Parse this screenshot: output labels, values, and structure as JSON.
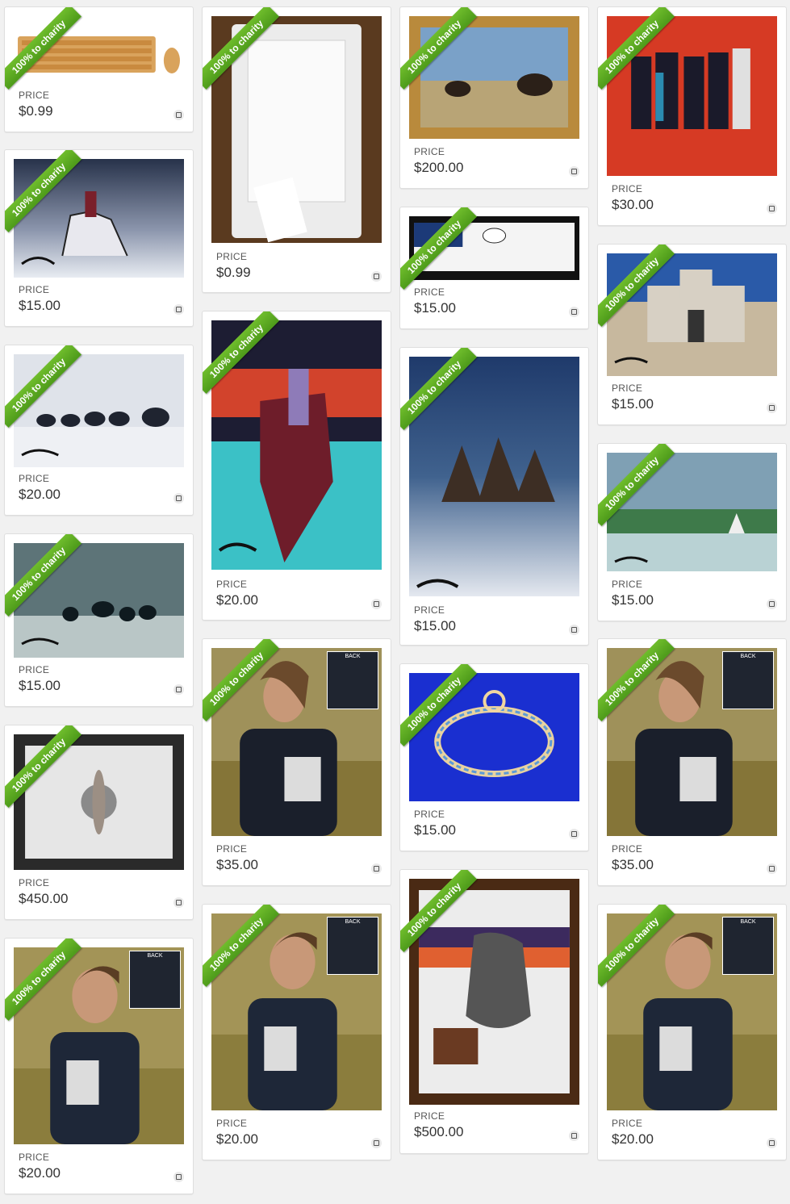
{
  "ribbon_text": "100% to charity",
  "price_label": "PRICE",
  "back_label": "BACK",
  "items": [
    {
      "price": "$0.99"
    },
    {
      "price": "$15.00"
    },
    {
      "price": "$20.00"
    },
    {
      "price": "$15.00"
    },
    {
      "price": "$450.00"
    },
    {
      "price": "$20.00"
    },
    {
      "price": "$0.99"
    },
    {
      "price": "$20.00"
    },
    {
      "price": "$35.00"
    },
    {
      "price": "$20.00"
    },
    {
      "price": "$200.00"
    },
    {
      "price": "$15.00"
    },
    {
      "price": "$15.00"
    },
    {
      "price": "$15.00"
    },
    {
      "price": "$500.00"
    },
    {
      "price": "$30.00"
    },
    {
      "price": "$15.00"
    },
    {
      "price": "$15.00"
    },
    {
      "price": "$35.00"
    },
    {
      "price": "$20.00"
    }
  ],
  "colors": {
    "ribbon_green": "#5aab22",
    "card_bg": "#ffffff",
    "page_bg": "#f1f1f1"
  }
}
